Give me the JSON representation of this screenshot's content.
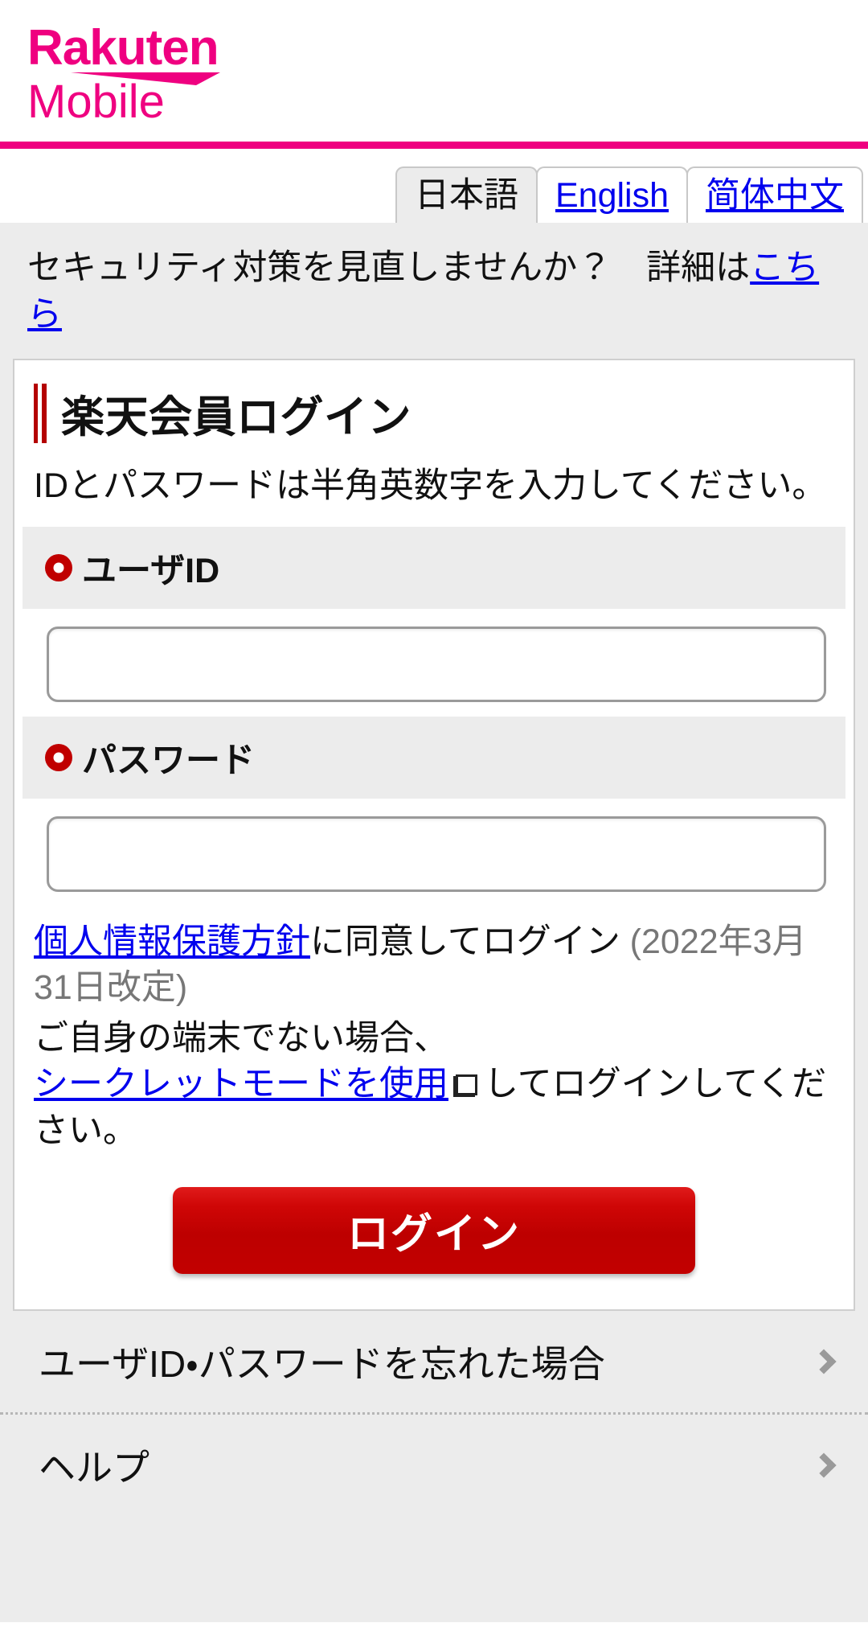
{
  "brand": {
    "name": "Rakuten",
    "sub": "Mobile",
    "color": "#ef0080"
  },
  "language": {
    "tabs": [
      {
        "label": "日本語",
        "active": true
      },
      {
        "label": "English",
        "active": false
      },
      {
        "label": "简体中文",
        "active": false
      }
    ]
  },
  "notice": {
    "text_before": "セキュリティ対策を見直しませんか？　詳細は",
    "link_label": "こちら"
  },
  "login_card": {
    "heading": "楽天会員ログイン",
    "description": "IDとパスワードは半角英数字を入力してください。",
    "user_id": {
      "label": "ユーザID",
      "value": "",
      "placeholder": ""
    },
    "password": {
      "label": "パスワード",
      "value": "",
      "placeholder": ""
    },
    "consent": {
      "link_label": "個人情報保護方針",
      "text_after": "に同意してログイン ",
      "revision": "(2022年3月31日改定)"
    },
    "device_note": {
      "line1": "ご自身の端末でない場合、",
      "link_label": "シークレットモードを使用",
      "icon": "external-link-icon",
      "text_after": "してログインしてください。"
    },
    "submit_label": "ログイン"
  },
  "bottom_links": [
    {
      "label": "ユーザID・パスワードを忘れた場合",
      "icon": "chevron-right-icon"
    },
    {
      "label": "ヘルプ",
      "icon": "chevron-right-icon"
    }
  ]
}
